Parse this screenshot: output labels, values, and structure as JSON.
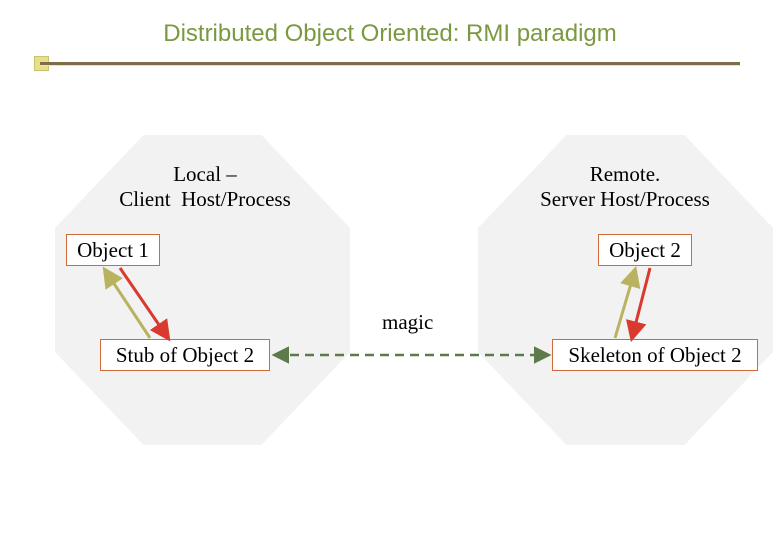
{
  "title": "Distributed Object Oriented: RMI paradigm",
  "hosts": {
    "local": "Local –\nClient  Host/Process",
    "remote": "Remote.\nServer Host/Process"
  },
  "boxes": {
    "object1": "Object 1",
    "stub": "Stub of Object 2",
    "object2": "Object 2",
    "skeleton": "Skeleton of Object 2"
  },
  "labels": {
    "magic": "magic"
  },
  "colors": {
    "title": "#7a9940",
    "border": "#cf6b3b",
    "arrowA": "#b9b35f",
    "arrowB": "#d83a2f",
    "dash": "#5c7a4a",
    "octagon": "#f2f2f2"
  }
}
